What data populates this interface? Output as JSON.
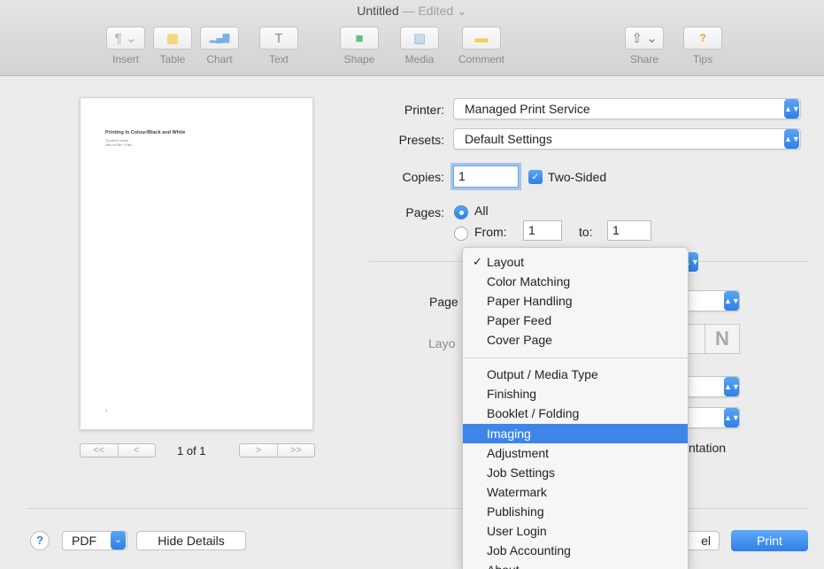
{
  "window": {
    "title": "Untitled",
    "status": "— Edited",
    "status_chevron": "⌄"
  },
  "toolbar": {
    "items": [
      {
        "label": "Insert",
        "icon": "paragraph-icon",
        "glyph": "¶ ⌄"
      },
      {
        "label": "Table",
        "icon": "table-icon",
        "glyph": "▦"
      },
      {
        "label": "Chart",
        "icon": "chart-icon",
        "glyph": "▂▄▇"
      },
      {
        "label": "Text",
        "icon": "text-icon",
        "glyph": "T"
      },
      {
        "label": "Shape",
        "icon": "shape-icon",
        "glyph": "■"
      },
      {
        "label": "Media",
        "icon": "media-icon",
        "glyph": "▨"
      },
      {
        "label": "Comment",
        "icon": "comment-icon",
        "glyph": "▬"
      },
      {
        "label": "Share",
        "icon": "share-icon",
        "glyph": "⇧ ⌄"
      },
      {
        "label": "Tips",
        "icon": "tips-icon",
        "glyph": "?"
      }
    ]
  },
  "preview": {
    "doc_title": "Printing In Colour/Black and White",
    "doc_lines": [
      "To print in colour:",
      "click on File > Print"
    ],
    "page_number_mark": "1",
    "page_indicator": "1 of 1",
    "nav": {
      "first": "<<",
      "prev": "<",
      "next": ">",
      "last": ">>"
    }
  },
  "form": {
    "printer_label": "Printer:",
    "printer_value": "Managed Print Service",
    "presets_label": "Presets:",
    "presets_value": "Default Settings",
    "copies_label": "Copies:",
    "copies_value": "1",
    "two_sided_label": "Two-Sided",
    "two_sided_checked": true,
    "pages_label": "Pages:",
    "pages_all_label": "All",
    "pages_from_label": "From:",
    "pages_from_value": "1",
    "pages_to_label": "to:",
    "pages_to_value": "1",
    "partial_page_label": "Page",
    "partial_layout_label": "Layo",
    "partial_orientation_label": "ntation",
    "layout_icon_glyph": "N"
  },
  "menu": {
    "group1": [
      {
        "label": "Layout",
        "checked": true
      },
      {
        "label": "Color Matching"
      },
      {
        "label": "Paper Handling"
      },
      {
        "label": "Paper Feed"
      },
      {
        "label": "Cover Page"
      }
    ],
    "group2": [
      {
        "label": "Output / Media Type"
      },
      {
        "label": "Finishing"
      },
      {
        "label": "Booklet / Folding"
      },
      {
        "label": "Imaging",
        "highlighted": true
      },
      {
        "label": "Adjustment"
      },
      {
        "label": "Job Settings"
      },
      {
        "label": "Watermark"
      },
      {
        "label": "Publishing"
      },
      {
        "label": "User Login"
      },
      {
        "label": "Job Accounting"
      },
      {
        "label": "About"
      }
    ]
  },
  "bottom": {
    "help": "?",
    "pdf_label": "PDF",
    "pdf_chevron": "⌄",
    "hide_details": "Hide Details",
    "cancel_partial": "el",
    "print": "Print"
  },
  "colors": {
    "accent": "#3d86e8",
    "toolbar": "#d9d9d9",
    "dialog": "#ececec"
  }
}
